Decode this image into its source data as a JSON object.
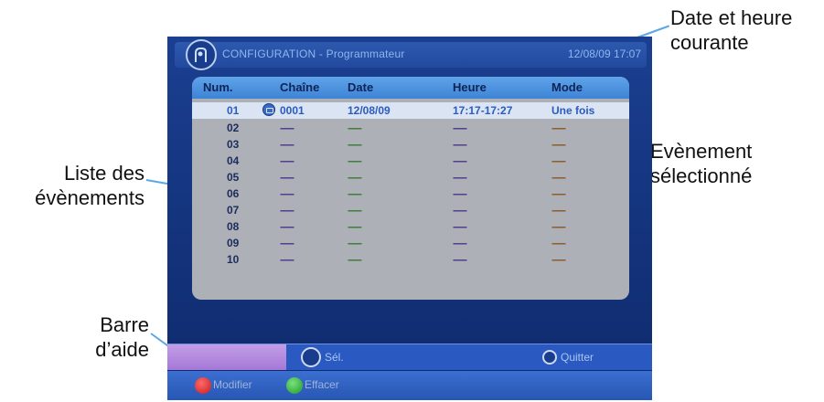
{
  "callouts": {
    "datetime": [
      "Date et heure",
      "courante"
    ],
    "event_list": [
      "Liste des",
      "évènements"
    ],
    "selected_event": [
      "Evènement",
      "sélectionné"
    ],
    "help_bar": [
      "Barre",
      "d’aide"
    ]
  },
  "topbar": {
    "title": "CONFIGURATION - Programmateur",
    "datetime": "12/08/09  17:07"
  },
  "list": {
    "headers": [
      "Num.",
      "Chaîne",
      "Date",
      "Heure",
      "Mode"
    ],
    "rows": [
      {
        "num": "01",
        "channel": "0001",
        "date": "12/08/09",
        "time": "17:17-17:27",
        "mode": "Une fois"
      },
      {
        "num": "02",
        "channel": "-----",
        "date": "-----",
        "time": "-----",
        "mode": "-----"
      },
      {
        "num": "03",
        "channel": "-----",
        "date": "-----",
        "time": "-----",
        "mode": "-----"
      },
      {
        "num": "04",
        "channel": "-----",
        "date": "-----",
        "time": "-----",
        "mode": "-----"
      },
      {
        "num": "05",
        "channel": "-----",
        "date": "-----",
        "time": "-----",
        "mode": "-----"
      },
      {
        "num": "06",
        "channel": "-----",
        "date": "-----",
        "time": "-----",
        "mode": "-----"
      },
      {
        "num": "07",
        "channel": "-----",
        "date": "-----",
        "time": "-----",
        "mode": "-----"
      },
      {
        "num": "08",
        "channel": "-----",
        "date": "-----",
        "time": "-----",
        "mode": "-----"
      },
      {
        "num": "09",
        "channel": "-----",
        "date": "-----",
        "time": "-----",
        "mode": "-----"
      },
      {
        "num": "10",
        "channel": "-----",
        "date": "-----",
        "time": "-----",
        "mode": "-----"
      }
    ],
    "selected_index": 0
  },
  "helpbar": {
    "select_label": "Sél.",
    "quit_label": "Quitter"
  },
  "colorbar": {
    "red_label": "Modifier",
    "green_label": "Effacer"
  },
  "colors": {
    "screen_bg": "#153681",
    "list_bg": "#adb0b6",
    "header_bg": "#4a8fdc",
    "selected_row": "#dbe4f3",
    "help_purple": "#b58ae0",
    "callout_line": "#5aa8e8"
  }
}
